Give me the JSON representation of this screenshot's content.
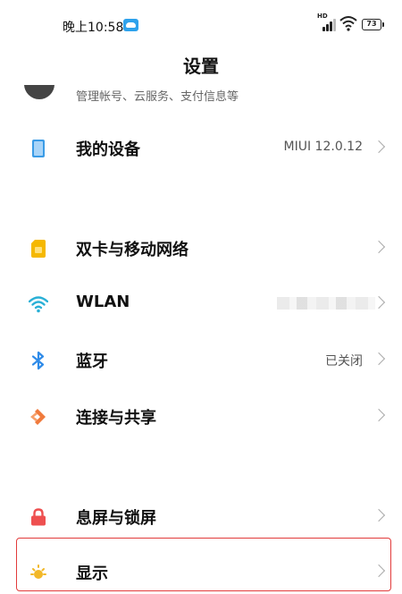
{
  "status_bar": {
    "time": "晚上10:58",
    "network_badge": "HD",
    "battery": "73",
    "icons": [
      "cloud-notification-icon",
      "signal-icon",
      "wifi-icon",
      "battery-icon"
    ]
  },
  "header": {
    "title": "设置"
  },
  "account_peek": {
    "subtitle": "管理帐号、云服务、支付信息等"
  },
  "rows": [
    {
      "key": "device",
      "label": "我的设备",
      "value": "MIUI 12.0.12",
      "icon": "phone-icon",
      "color": "#3a9be6"
    },
    {
      "key": "sim",
      "label": "双卡与移动网络",
      "value": "",
      "icon": "sim-card-icon",
      "color": "#f5b800"
    },
    {
      "key": "wlan",
      "label": "WLAN",
      "value": "",
      "icon": "wifi-icon",
      "color": "#2ab0d6"
    },
    {
      "key": "bluetooth",
      "label": "蓝牙",
      "value": "已关闭",
      "icon": "bluetooth-icon",
      "color": "#2f8be8"
    },
    {
      "key": "share",
      "label": "连接与共享",
      "value": "",
      "icon": "share-icon",
      "color": "#f07a3c"
    },
    {
      "key": "lock",
      "label": "息屏与锁屏",
      "value": "",
      "icon": "lock-icon",
      "color": "#ee5050"
    },
    {
      "key": "display",
      "label": "显示",
      "value": "",
      "icon": "brightness-icon",
      "color": "#f2b829"
    }
  ]
}
